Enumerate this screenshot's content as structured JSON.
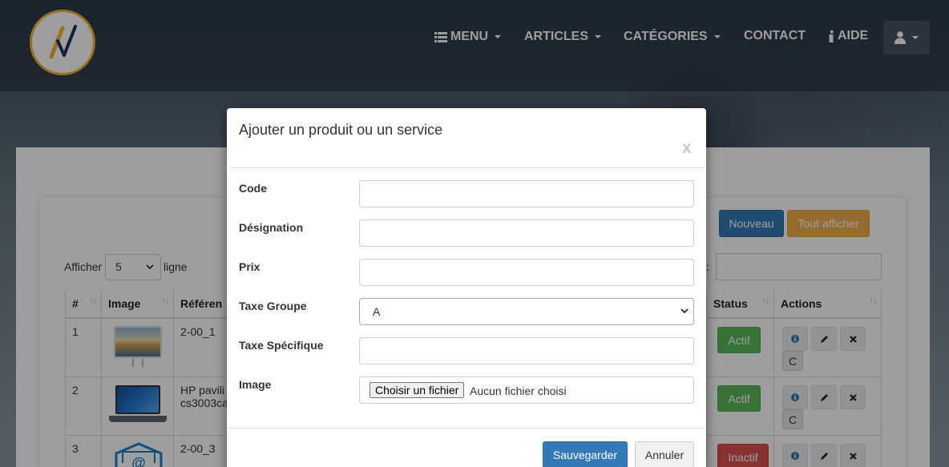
{
  "navbar": {
    "menu_label": "MENU",
    "articles_label": "ARTICLES",
    "categories_label": "CATÉGORIES",
    "contact_label": "CONTACT",
    "aide_label": "AIDE"
  },
  "toolbar": {
    "new_label": "Nouveau",
    "show_all_label": "Tout afficher"
  },
  "pagination": {
    "show_label": "Afficher",
    "page_size": "5",
    "rows_label": "ligne",
    "search_colon": ":"
  },
  "table": {
    "columns": [
      "#",
      "Image",
      "Référen",
      "Status",
      "Actions"
    ],
    "rows": [
      {
        "num": "1",
        "ref": "2-00_1",
        "ref2": "",
        "status": "Actif",
        "status_color": "#5cb85c"
      },
      {
        "num": "2",
        "ref": "HP pavili",
        "ref2": "cs3003ca",
        "status": "Actif",
        "status_color": "#5cb85c"
      },
      {
        "num": "3",
        "ref": "2-00_3",
        "ref2": "",
        "status": "Inactif",
        "status_color": "#d9534f"
      }
    ],
    "action_c_label": "C"
  },
  "modal": {
    "title": "Ajouter un produit ou un service",
    "close_label": "x",
    "fields": {
      "code_label": "Code",
      "designation_label": "Désignation",
      "prix_label": "Prix",
      "taxe_groupe_label": "Taxe Groupe",
      "taxe_groupe_value": "A",
      "taxe_specifique_label": "Taxe Spécifique",
      "image_label": "Image",
      "file_button_label": "Choisir un fichier",
      "file_status": "Aucun fichier choisi"
    },
    "save_label": "Sauvegarder",
    "cancel_label": "Annuler"
  },
  "colors": {
    "primary": "#337ab7",
    "warning": "#f0ad4e",
    "success": "#5cb85c",
    "danger": "#d9534f",
    "logo_accent": "#f2b535",
    "logo_navy": "#1d3457"
  }
}
